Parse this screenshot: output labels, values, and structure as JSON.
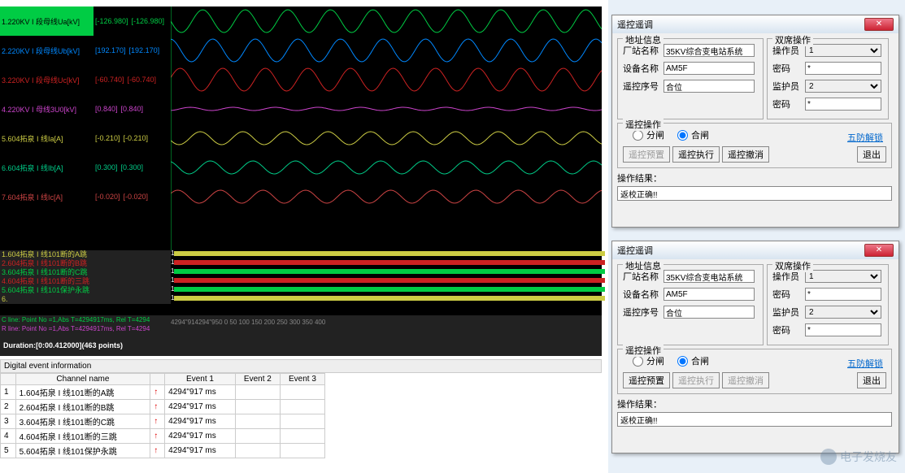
{
  "waveform": {
    "channels": [
      {
        "name": "1.220KV I 段母线Ua[kV]",
        "color": "#0c4",
        "v1": "[-126.980]",
        "v2": "[-126.980]",
        "active": true
      },
      {
        "name": "2.220KV I 段母线Ub[kV]",
        "color": "#08f",
        "v1": "[192.170]",
        "v2": "[192.170]"
      },
      {
        "name": "3.220KV I 段母线Uc[kV]",
        "color": "#c22",
        "v1": "[-60.740]",
        "v2": "[-60.740]"
      },
      {
        "name": "4.220KV I 母线3U0[kV]",
        "color": "#c4c",
        "v1": "[0.840]",
        "v2": "[0.840]"
      },
      {
        "name": "5.604拓泉 I 线Ia[A]",
        "color": "#cc4",
        "v1": "[-0.210]",
        "v2": "[-0.210]"
      },
      {
        "name": "6.604拓泉 I 线Ib[A]",
        "color": "#0c8",
        "v1": "[0.300]",
        "v2": "[0.300]"
      },
      {
        "name": "7.604拓泉 I 线Ic[A]",
        "color": "#c44",
        "v1": "[-0.020]",
        "v2": "[-0.020]"
      }
    ],
    "digital_channels": [
      {
        "name": "1.604拓泉 I 线101断的A跳",
        "color": "#cc4"
      },
      {
        "name": "2.604拓泉 I 线101断的B跳",
        "color": "#c22"
      },
      {
        "name": "3.604拓泉 I 线101断的C跳",
        "color": "#0c4"
      },
      {
        "name": "4.604拓泉 I 线101断的三跳",
        "color": "#c22"
      },
      {
        "name": "5.604拓泉 I 线101保护永跳",
        "color": "#0c4"
      },
      {
        "name": "6.",
        "color": "#cc4"
      }
    ],
    "cursor_lines": [
      "C line: Point No =1,Abs T=4294917ms, Rel T=4294",
      "R line: Point No =1,Abs T=4294917ms, Rel T=4294"
    ],
    "cursor_colors": [
      "#0c4",
      "#c4c"
    ],
    "duration": "Duration:[0:00.412000](463 points)",
    "time_ticks": "4294\"914294\"950 0         50        100        150        200        250        300        350        400"
  },
  "event_section": {
    "title": "Digital event information",
    "headers": [
      "",
      "Channel name",
      "",
      "Event 1",
      "Event 2",
      "Event 3"
    ],
    "rows": [
      {
        "n": "1",
        "name": "1.604拓泉 I 线101断的A跳",
        "arrow": "↑",
        "e1": "4294\"917 ms"
      },
      {
        "n": "2",
        "name": "2.604拓泉 I 线101断的B跳",
        "arrow": "↑",
        "e1": "4294\"917 ms"
      },
      {
        "n": "3",
        "name": "3.604拓泉 I 线101断的C跳",
        "arrow": "↑",
        "e1": "4294\"917 ms"
      },
      {
        "n": "4",
        "name": "4.604拓泉 I 线101断的三跳",
        "arrow": "↑",
        "e1": "4294\"917 ms"
      },
      {
        "n": "5",
        "name": "5.604拓泉 I 线101保护永跳",
        "arrow": "↑",
        "e1": "4294\"917 ms"
      }
    ]
  },
  "dialog": {
    "title": "遥控遥调",
    "addr": {
      "legend": "地址信息",
      "station_label": "厂站名称",
      "station_value": "35KV综合变电站系统",
      "device_label": "设备名称",
      "device_value": "AM5F",
      "seq_label": "遥控序号",
      "seq_value": "合位"
    },
    "dual": {
      "legend": "双席操作",
      "operator_label": "操作员",
      "operator_value": "1",
      "pwd1_label": "密码",
      "pwd1_value": "*",
      "guardian_label": "监护员",
      "guardian_value": "2",
      "pwd2_label": "密码",
      "pwd2_value": "*"
    },
    "ctrl": {
      "legend": "遥控操作",
      "radio_open": "分闸",
      "radio_close": "合闸",
      "btn_preset": "遥控预置",
      "btn_exec": "遥控执行",
      "btn_cancel": "遥控撤消",
      "btn_unlock": "五防解锁",
      "btn_exit": "退出"
    },
    "result": {
      "label": "操作结果：",
      "value": "返校正确!!"
    }
  },
  "watermark": "电子发烧友"
}
